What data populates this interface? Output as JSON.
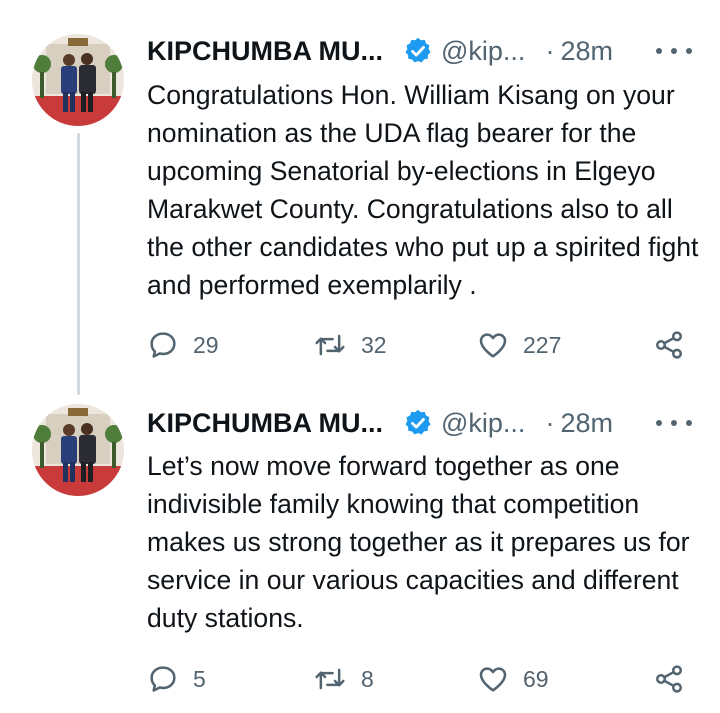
{
  "tweets": [
    {
      "author": "KIPCHUMBA MU...",
      "handle": "@kip...",
      "separator": "·",
      "time": "28m",
      "text": "Congratulations Hon. William Kisang on your nomination as the UDA flag bearer for the upcoming Senatorial by-elections in Elgeyo Marakwet County. Congratulations also to all the other candidates who put up a spirited fight and performed exemplarily .",
      "replies": "29",
      "retweets": "32",
      "likes": "227"
    },
    {
      "author": "KIPCHUMBA MU...",
      "handle": "@kip...",
      "separator": "·",
      "time": "28m",
      "text": "Let’s now move forward together as one indivisible family knowing that competition makes us strong together as it prepares us for service in our various capacities and different duty stations.",
      "replies": "5",
      "retweets": "8",
      "likes": "69"
    }
  ],
  "icons": {
    "verified": "verified-badge-icon",
    "more": "more-dots-icon",
    "reply": "reply-bubble-icon",
    "retweet": "retweet-arrows-icon",
    "like": "heart-icon",
    "share": "share-nodes-icon"
  },
  "colors": {
    "verified_blue": "#1d9bf0",
    "secondary_text": "#536471",
    "thread_line": "#cfd9de"
  }
}
